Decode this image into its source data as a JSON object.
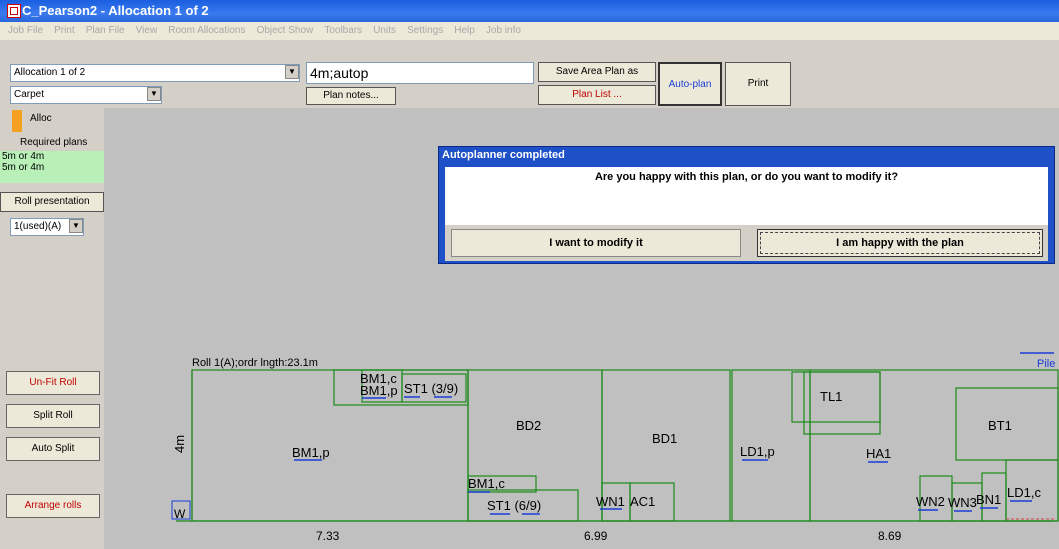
{
  "window": {
    "title": "C_Pearson2 - Allocation 1 of 2"
  },
  "menu": [
    "Job File",
    "Print",
    "Plan File",
    "View",
    "Room Allocations",
    "Object Show",
    "Toolbars",
    "Units",
    "Settings",
    "Help",
    "Job info"
  ],
  "toolbar": {
    "allocation_select": "Allocation 1 of 2",
    "material_select": "Carpet",
    "plan_input": "4m;autop",
    "plan_notes_label": "Plan notes...",
    "save_area_label": "Save Area Plan as",
    "plan_list_label": "Plan List ...",
    "autoplan_label": "Auto-plan",
    "print_label": "Print"
  },
  "left": {
    "alloc_label": "Alloc",
    "required_label": "Required plans",
    "required_items": [
      "5m or 4m",
      "5m or 4m"
    ],
    "roll_presentation_label": "Roll presentation",
    "roll_select": "1(used)(A)",
    "unfit_label": "Un-Fit Roll",
    "split_label": "Split Roll",
    "autosplit_label": "Auto Split",
    "arrange_label": "Arrange rolls"
  },
  "dialog": {
    "title": "Autoplanner completed",
    "message": "Are you happy with this plan, or do you want to modify it?",
    "modify_label": "I want to modify it",
    "happy_label": "I am happy with the plan"
  },
  "plan": {
    "roll_label": "Roll 1(A);ordr lngth:23.1m",
    "width_label": "4m",
    "pile_label": "Pile",
    "w_label": "W",
    "pieces": {
      "bm1p_top1": "BM1,c",
      "bm1p_top2": "BM1,p",
      "st1_39": "ST1 (3/9)",
      "bm1p": "BM1,p",
      "bd2": "BD2",
      "bd1": "BD1",
      "bm1c_bottom": "BM1,c",
      "st1_69": "ST1 (6/9)",
      "wn1": "WN1",
      "ac1": "AC1",
      "ld1p": "LD1,p",
      "tl1": "TL1",
      "ha1": "HA1",
      "bt1": "BT1",
      "wn2": "WN2",
      "wn3": "WN3",
      "bn1": "BN1",
      "ld1c": "LD1,c"
    },
    "dimensions": [
      "7.33",
      "6.99",
      "8.69"
    ]
  },
  "colors": {
    "accent": "#1e50c8",
    "piece": "#1a8a1a",
    "arrow": "#1a3cd8",
    "alloc": "#f5a020",
    "required_bg": "#b8f0b8",
    "red_label": "#c00000"
  }
}
